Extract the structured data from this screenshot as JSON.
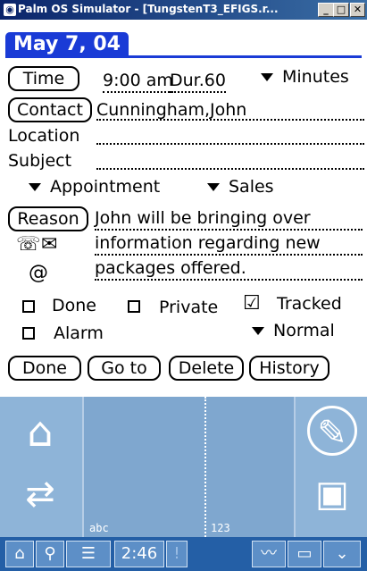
{
  "window": {
    "title": "Palm OS Simulator - [TungstenT3_EFIGS.r...",
    "minimize_label": "_",
    "maximize_label": "□",
    "close_label": "✕"
  },
  "form": {
    "title": "May 7, 04",
    "time_button": "Time",
    "time_value": "9:00 am",
    "duration_value": "Dur.60",
    "duration_unit": "Minutes",
    "contact_button": "Contact",
    "contact_value": "Cunningham,John",
    "location_label": "Location",
    "location_value": "",
    "subject_label": "Subject",
    "subject_value": "",
    "type_value": "Appointment",
    "category_value": "Sales",
    "reason_button": "Reason",
    "reason_lines": [
      "John will be bringing over",
      "information regarding new",
      "packages offered."
    ],
    "done_checkbox": "Done",
    "private_checkbox": "Private",
    "tracked_checkbox": "Tracked",
    "alarm_checkbox": "Alarm",
    "priority_value": "Normal",
    "buttons": {
      "done": "Done",
      "goto": "Go to",
      "delete": "Delete",
      "history": "History"
    }
  },
  "graffiti": {
    "abc_label": "abc",
    "num_label": "123"
  },
  "status": {
    "time": "2:46",
    "alert": "!"
  }
}
